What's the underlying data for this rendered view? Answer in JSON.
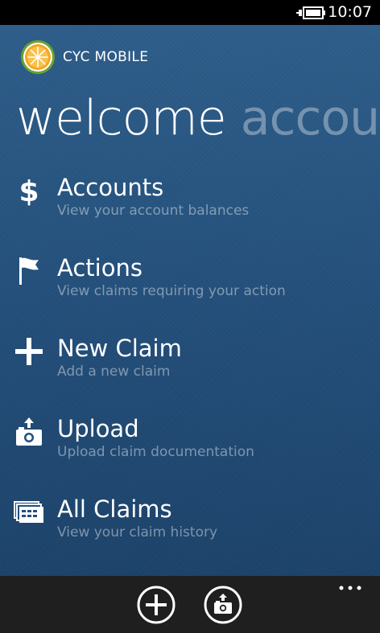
{
  "status_bar": {
    "time": "10:07",
    "battery_icon": "battery-charging-icon"
  },
  "app": {
    "title": "CYC MOBILE",
    "logo_icon": "orange-slice-logo-icon"
  },
  "pivot": {
    "active": "welcome",
    "next": "accou"
  },
  "menu": {
    "items": [
      {
        "icon": "dollar-icon",
        "title": "Accounts",
        "subtitle": "View your account balances"
      },
      {
        "icon": "flag-icon",
        "title": "Actions",
        "subtitle": "View claims requiring your action"
      },
      {
        "icon": "plus-icon",
        "title": "New Claim",
        "subtitle": "Add a new claim"
      },
      {
        "icon": "camera-upload-icon",
        "title": "Upload",
        "subtitle": "Upload claim documentation"
      },
      {
        "icon": "claims-list-icon",
        "title": "All Claims",
        "subtitle": "View your claim history"
      }
    ]
  },
  "app_bar": {
    "buttons": [
      {
        "icon": "add-circle-icon"
      },
      {
        "icon": "camera-upload-circle-icon"
      }
    ],
    "more_icon": "more-dots-icon"
  },
  "colors": {
    "background_top": "#2d5d8a",
    "background_bottom": "#1b426a",
    "app_bar": "#1f1f1f",
    "logo_orange": "#f5a623",
    "logo_ring": "#6aa42f"
  }
}
